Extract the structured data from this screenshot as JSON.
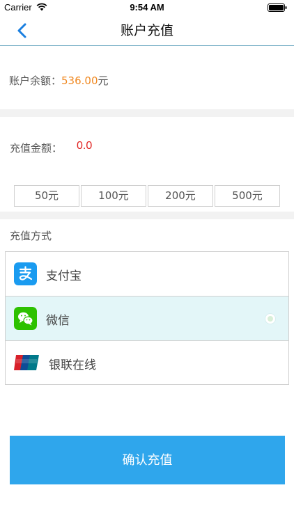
{
  "status_bar": {
    "carrier": "Carrier",
    "time": "9:54 AM"
  },
  "nav": {
    "title": "账户充值",
    "back_icon": "chevron-left-icon"
  },
  "balance": {
    "label": "账户余额：",
    "amount": "536.00",
    "unit": "元",
    "amount_color": "#f08a24"
  },
  "recharge": {
    "label": "充值金额：",
    "value": "0.0",
    "value_color": "#e0201e"
  },
  "presets": [
    "50元",
    "100元",
    "200元",
    "500元"
  ],
  "methods": {
    "title": "充值方式",
    "items": [
      {
        "label": "支付宝",
        "icon": "alipay-icon",
        "selected": false
      },
      {
        "label": "微信",
        "icon": "wechat-icon",
        "selected": true
      },
      {
        "label": "银联在线",
        "icon": "unionpay-icon",
        "selected": false
      }
    ]
  },
  "confirm": {
    "label": "确认充值",
    "color": "#2fa6ec"
  }
}
